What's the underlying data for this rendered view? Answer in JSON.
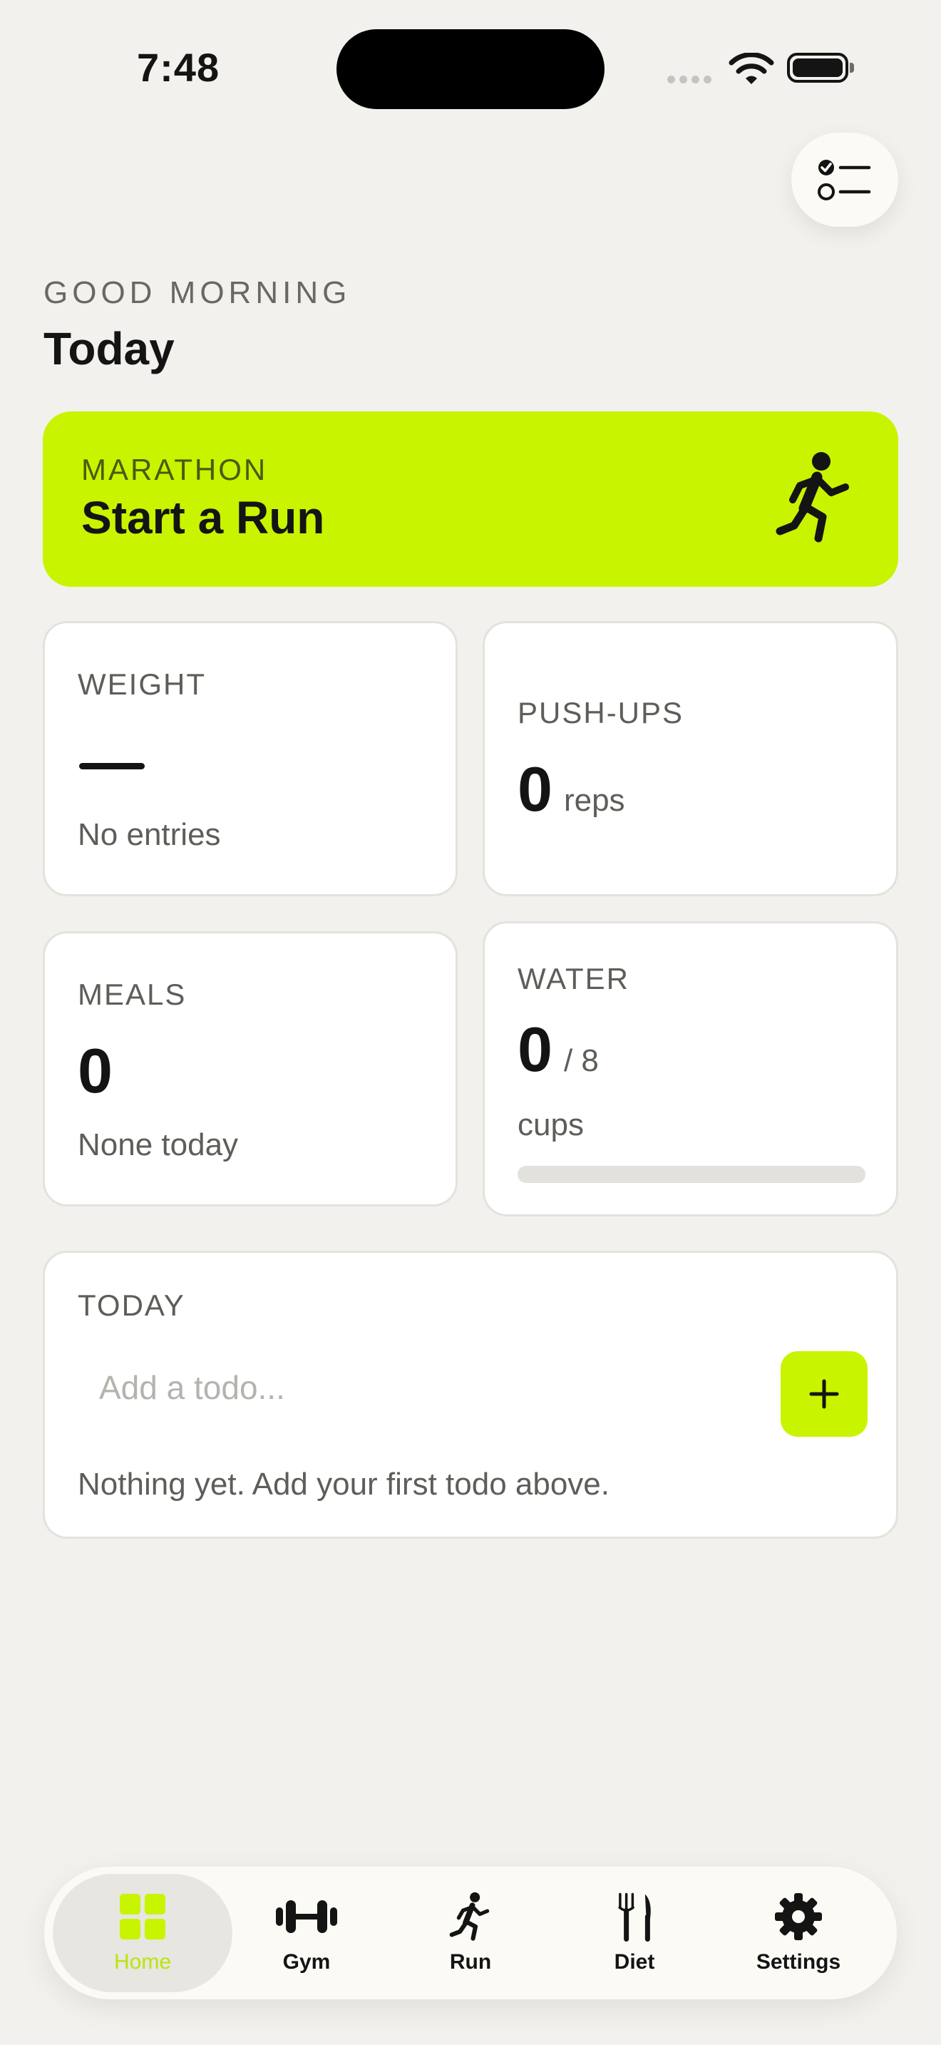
{
  "status_bar": {
    "time": "7:48"
  },
  "header": {
    "greeting": "GOOD MORNING",
    "title": "Today"
  },
  "run_card": {
    "eyebrow": "MARATHON",
    "title": "Start a Run",
    "icon": "running-person-icon"
  },
  "stats": {
    "weight": {
      "label": "WEIGHT",
      "value": "—",
      "sub": "No entries"
    },
    "pushups": {
      "label": "PUSH-UPS",
      "value": "0",
      "unit": "reps"
    },
    "meals": {
      "label": "MEALS",
      "value": "0",
      "sub": "None today"
    },
    "water": {
      "label": "WATER",
      "value": "0",
      "goal": "/ 8",
      "unit": "cups",
      "progress": 0
    }
  },
  "todo": {
    "label": "TODAY",
    "placeholder": "Add a todo...",
    "add_icon": "plus-icon",
    "empty_text": "Nothing yet. Add your first todo above."
  },
  "tabs": [
    {
      "label": "Home",
      "icon": "grid-icon",
      "active": true
    },
    {
      "label": "Gym",
      "icon": "dumbbell-icon",
      "active": false
    },
    {
      "label": "Run",
      "icon": "running-person-icon",
      "active": false
    },
    {
      "label": "Diet",
      "icon": "fork-knife-icon",
      "active": false
    },
    {
      "label": "Settings",
      "icon": "gear-icon",
      "active": false
    }
  ],
  "colors": {
    "accent": "#c8f400",
    "background": "#f2f1ed",
    "card": "#ffffff",
    "text": "#141414",
    "muted": "#5f5d58"
  }
}
